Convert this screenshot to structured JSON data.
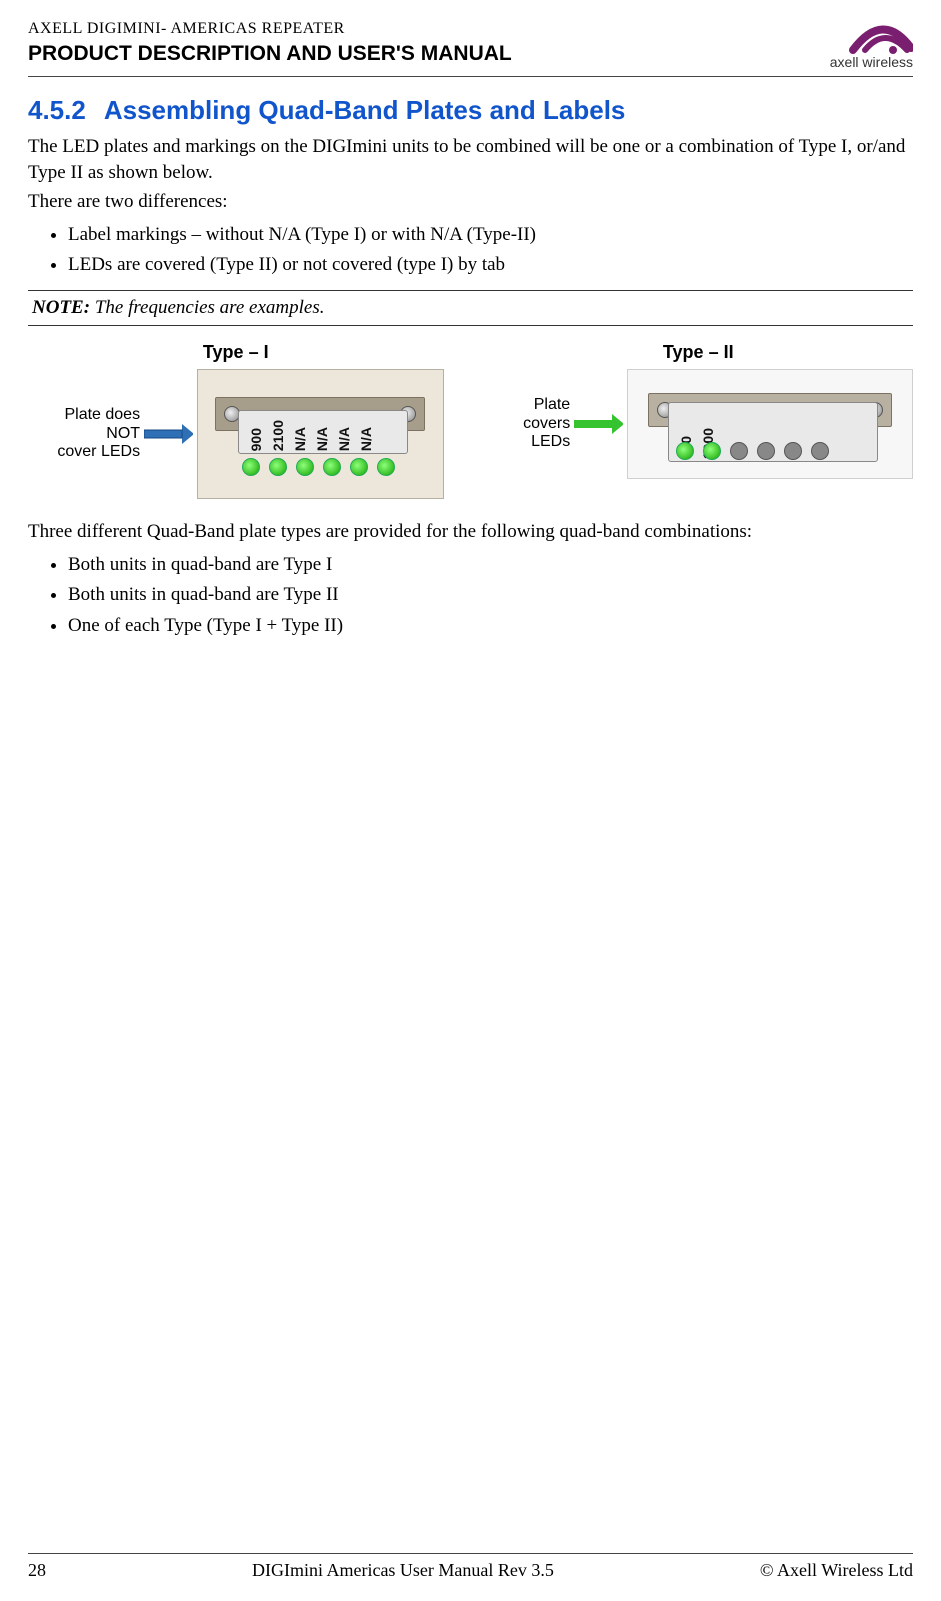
{
  "header": {
    "product_line": "AXELL DIGIMINI- AMERICAS REPEATER",
    "manual_title": "PRODUCT DESCRIPTION AND USER'S MANUAL",
    "logo_text": "axell wireless"
  },
  "section": {
    "number": "4.5.2",
    "title": "Assembling Quad-Band Plates and Labels"
  },
  "paragraphs": {
    "intro": "The LED plates and markings on the DIGImini units to be combined will be one or a combination of Type I, or/and Type II as shown below.",
    "diffs_lead": "There are two differences:",
    "second_lead": "Three different Quad-Band plate types are provided for the following quad-band combinations:"
  },
  "diff_bullets": [
    "Label markings – without N/A (Type I) or with N/A (Type-II)",
    "LEDs are covered (Type II) or not covered (type I) by tab"
  ],
  "note": {
    "label": "NOTE:",
    "text": "The frequencies are examples."
  },
  "diagrams": {
    "type1": {
      "title": "Type – I",
      "caption_line1": "Plate does NOT",
      "caption_line2": "cover LEDs",
      "plate_labels": [
        "900",
        "2100",
        "N/A",
        "N/A",
        "N/A",
        "N/A"
      ]
    },
    "type2": {
      "title": "Type – II",
      "caption_line1": "Plate covers",
      "caption_line2": "LEDs",
      "plate_labels": [
        "850",
        "1900"
      ]
    }
  },
  "combo_bullets": [
    "Both units in quad-band are Type I",
    "Both units in quad-band are Type II",
    "One of each Type (Type I + Type II)"
  ],
  "footer": {
    "page": "28",
    "center": "DIGImini Americas User Manual Rev 3.5",
    "right": "© Axell Wireless Ltd"
  }
}
